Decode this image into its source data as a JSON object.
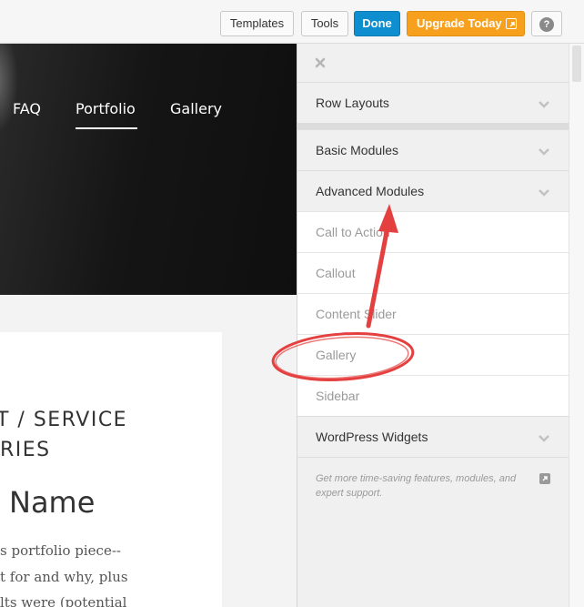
{
  "toolbar": {
    "templates_label": "Templates",
    "tools_label": "Tools",
    "done_label": "Done",
    "upgrade_label": "Upgrade Today",
    "help_label": "?"
  },
  "site": {
    "nav": [
      {
        "label": "FAQ",
        "active": false
      },
      {
        "label": "Portfolio",
        "active": true
      },
      {
        "label": "Gallery",
        "active": false
      }
    ],
    "category_line1": "T / SERVICE",
    "category_line2": "RIES",
    "project_name": "Name",
    "description_lines": [
      "s portfolio piece--",
      "t for and why, plus",
      "lts were (potential"
    ]
  },
  "panel": {
    "sections": [
      {
        "label": "Row Layouts"
      },
      {
        "label": "Basic Modules"
      },
      {
        "label": "Advanced Modules",
        "expanded": true
      }
    ],
    "advanced_items": [
      {
        "label": "Call to Action"
      },
      {
        "label": "Callout"
      },
      {
        "label": "Content Slider"
      },
      {
        "label": "Gallery"
      },
      {
        "label": "Sidebar"
      }
    ],
    "widgets_label": "WordPress Widgets",
    "upgrade_note": "Get more time-saving features, modules, and expert support."
  },
  "colors": {
    "done_blue": "#0e8ecf",
    "upgrade_orange": "#f7a01e",
    "annotation_red": "#e4403f"
  }
}
